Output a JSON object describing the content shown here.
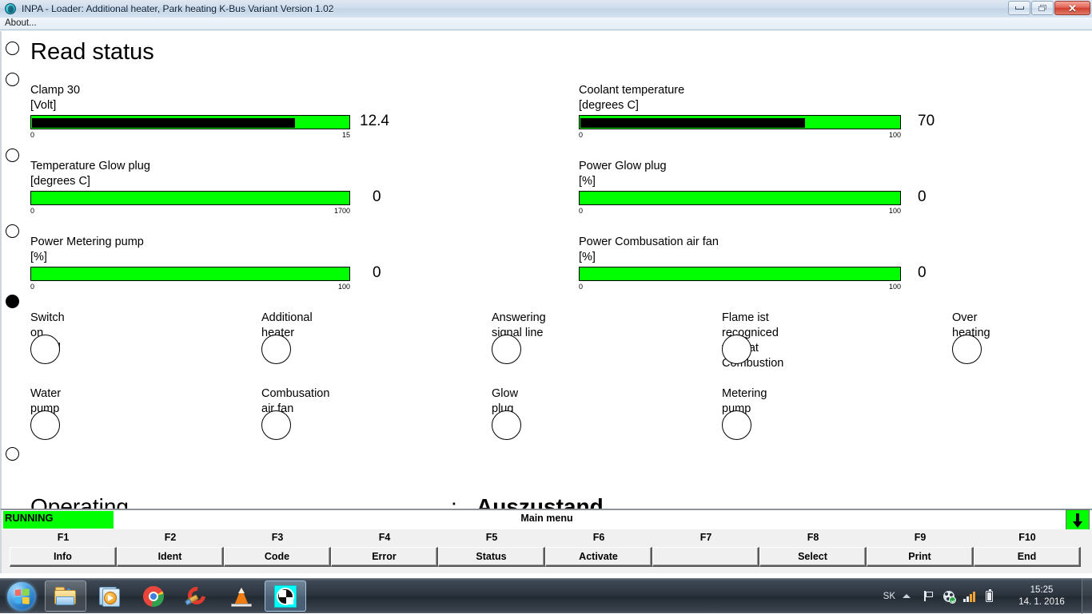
{
  "window": {
    "title": "INPA - Loader:  Additional heater, Park heating K-Bus Variant Version 1.02",
    "app_icon": "globe-icon",
    "minimize_label": "Minimize",
    "maximize_label": "Restore",
    "close_label": "Close",
    "menu": [
      {
        "label": "About..."
      }
    ]
  },
  "page": {
    "heading": "Read status"
  },
  "gauges": [
    {
      "name": "clamp-30",
      "label": "Clamp 30\n[Volt]",
      "value": "12.4",
      "value_num": 12.4,
      "min": "0",
      "max": "15",
      "min_num": 0,
      "max_num": 15,
      "fill_percent": 82.7
    },
    {
      "name": "coolant-temperature",
      "label": "Coolant temperature\n[degrees C]",
      "value": "70",
      "value_num": 70,
      "min": "0",
      "max": "100",
      "min_num": 0,
      "max_num": 100,
      "fill_percent": 70
    },
    {
      "name": "temperature-glow-plug",
      "label": "Temperature Glow plug\n[degrees C]",
      "value": "0",
      "value_num": 0,
      "min": "0",
      "max": "1700",
      "min_num": 0,
      "max_num": 1700,
      "fill_percent": 0
    },
    {
      "name": "power-glow-plug",
      "label": "Power Glow plug\n[%]",
      "value": "0",
      "value_num": 0,
      "min": "0",
      "max": "100",
      "min_num": 0,
      "max_num": 100,
      "fill_percent": 0
    },
    {
      "name": "power-metering-pump",
      "label": "Power Metering pump\n[%]",
      "value": "0",
      "value_num": 0,
      "min": "0",
      "max": "100",
      "min_num": 0,
      "max_num": 100,
      "fill_percent": 0
    },
    {
      "name": "power-combusation-air-fan",
      "label": "Power Combusation air fan\n[%]",
      "value": "0",
      "value_num": 0,
      "min": "0",
      "max": "100",
      "min_num": 0,
      "max_num": 100,
      "fill_percent": 0
    }
  ],
  "indicators": [
    {
      "name": "switch-on-signal",
      "label": "Switch on signal",
      "state": "off"
    },
    {
      "name": "additional-heater",
      "label": "Additional heater",
      "state": "off"
    },
    {
      "name": "answering-signal-line",
      "label": "Answering signal line",
      "state": "off"
    },
    {
      "name": "flame-recogniced",
      "label": "Flame ist recogniced\nvalid at Combustion",
      "state": "off"
    },
    {
      "name": "over-heating",
      "label": "Over heating",
      "state": "off"
    },
    {
      "name": "water-pump",
      "label": "Water pump",
      "state": "off"
    },
    {
      "name": "combusation-air-fan",
      "label": "Combusation air fan",
      "state": "off"
    },
    {
      "name": "glow-plug",
      "label": "Glow plug",
      "state": "off"
    },
    {
      "name": "metering-pump",
      "label": "Metering pump",
      "state": "off"
    }
  ],
  "operating_condition": {
    "label": "Operating condition",
    "separator": ":",
    "value": "Auszustand"
  },
  "statusbar": {
    "running_label": "RUNNING",
    "center_label": "Main menu",
    "scroll_icon": "arrow-down-icon"
  },
  "function_keys": [
    {
      "key": "F1",
      "label": "Info"
    },
    {
      "key": "F2",
      "label": "Ident"
    },
    {
      "key": "F3",
      "label": "Code"
    },
    {
      "key": "F4",
      "label": "Error"
    },
    {
      "key": "F5",
      "label": "Status"
    },
    {
      "key": "F6",
      "label": "Activate"
    },
    {
      "key": "F7",
      "label": ""
    },
    {
      "key": "F8",
      "label": "Select"
    },
    {
      "key": "F9",
      "label": "Print"
    },
    {
      "key": "F10",
      "label": "End"
    }
  ],
  "taskbar": {
    "start_label": "Start",
    "apps": [
      {
        "name": "windows-explorer-icon",
        "state": "pinned"
      },
      {
        "name": "media-player-icon",
        "state": "normal"
      },
      {
        "name": "google-chrome-icon",
        "state": "normal"
      },
      {
        "name": "ccleaner-icon",
        "state": "normal"
      },
      {
        "name": "vlc-media-player-icon",
        "state": "normal"
      },
      {
        "name": "inpa-bmw-icon",
        "state": "active"
      }
    ],
    "tray": {
      "language": "SK",
      "icons": [
        "show-hidden-icons-chevron",
        "action-center-flag-icon",
        "antivirus-shield-icon",
        "network-signal-icon",
        "battery-icon"
      ],
      "time": "15:25",
      "date": "14. 1. 2016"
    }
  },
  "colors": {
    "gauge_track": "#00ff00",
    "gauge_fill": "#000000",
    "running_badge": "#00ff00",
    "window_text": "#000000"
  },
  "left_markers": [
    {
      "state": "empty"
    },
    {
      "state": "empty"
    },
    {
      "state": "empty"
    },
    {
      "state": "empty"
    },
    {
      "state": "filled"
    },
    {
      "state": "empty"
    }
  ]
}
